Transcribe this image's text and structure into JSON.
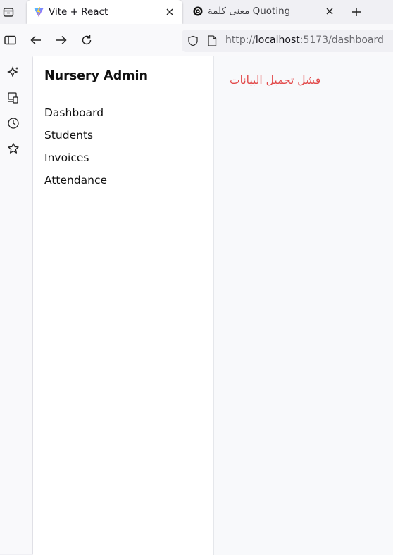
{
  "browser": {
    "tabs": [
      {
        "title": "Vite + React",
        "active": true,
        "favicon": "vite-icon"
      },
      {
        "title": "معنى كلمة Quoting",
        "active": false,
        "favicon": "chatgpt-icon"
      }
    ],
    "url": {
      "scheme": "http://",
      "host": "localhost",
      "rest": ":5173/dashboard"
    }
  },
  "app": {
    "brand": "Nursery Admin",
    "nav": [
      "Dashboard",
      "Students",
      "Invoices",
      "Attendance"
    ],
    "error_message": "فشل تحميل البيانات"
  },
  "colors": {
    "error": "#e24b4b",
    "main_bg": "#f8f9fb"
  }
}
